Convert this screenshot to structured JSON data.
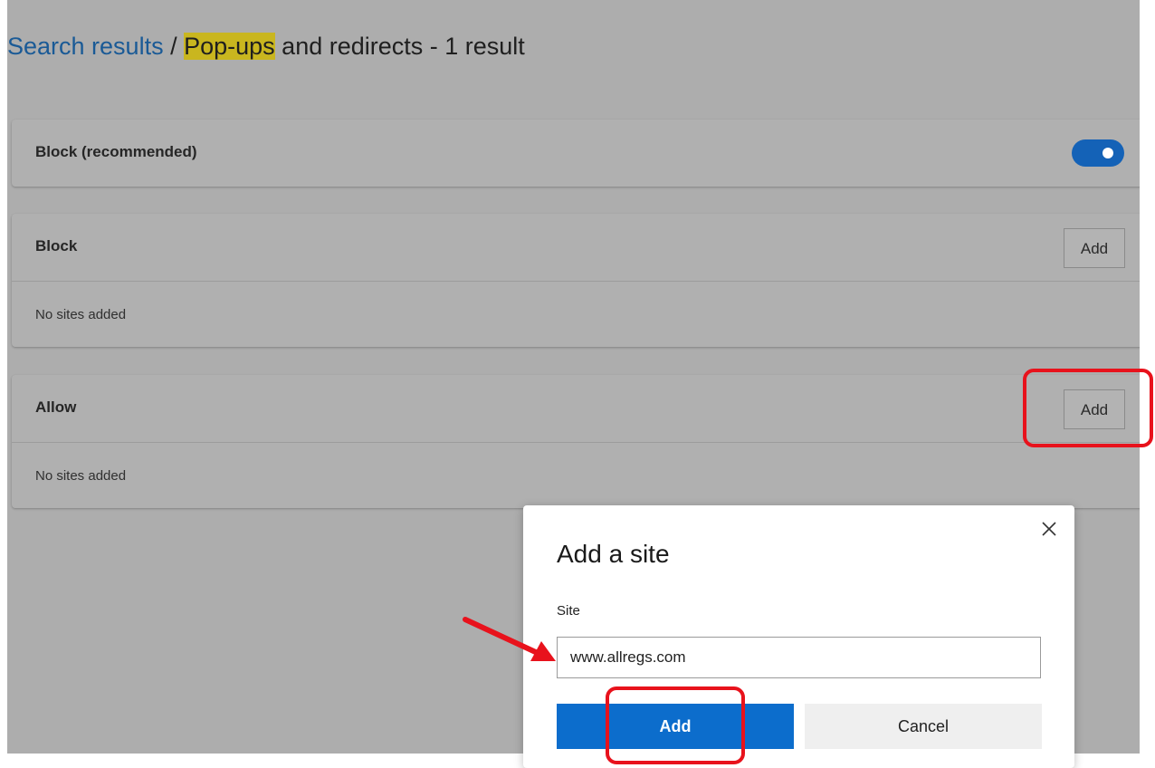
{
  "header": {
    "crumb_link": "Search results",
    "separator": " / ",
    "highlight": "Pop-ups",
    "rest": " and redirects - 1 result"
  },
  "block_recommended": {
    "label": "Block (recommended)",
    "toggle_on": true
  },
  "block": {
    "label": "Block",
    "add_label": "Add",
    "empty_text": "No sites added"
  },
  "allow": {
    "label": "Allow",
    "add_label": "Add",
    "empty_text": "No sites added"
  },
  "dialog": {
    "title": "Add a site",
    "close_icon": "close-icon",
    "field_label": "Site",
    "site_value": "www.allregs.com",
    "add_label": "Add",
    "cancel_label": "Cancel"
  },
  "colors": {
    "accent": "#0c6dcc",
    "toggle": "#1462b7",
    "highlight": "#c9b61f",
    "link": "#1a5a96",
    "callout": "#e8121c"
  }
}
